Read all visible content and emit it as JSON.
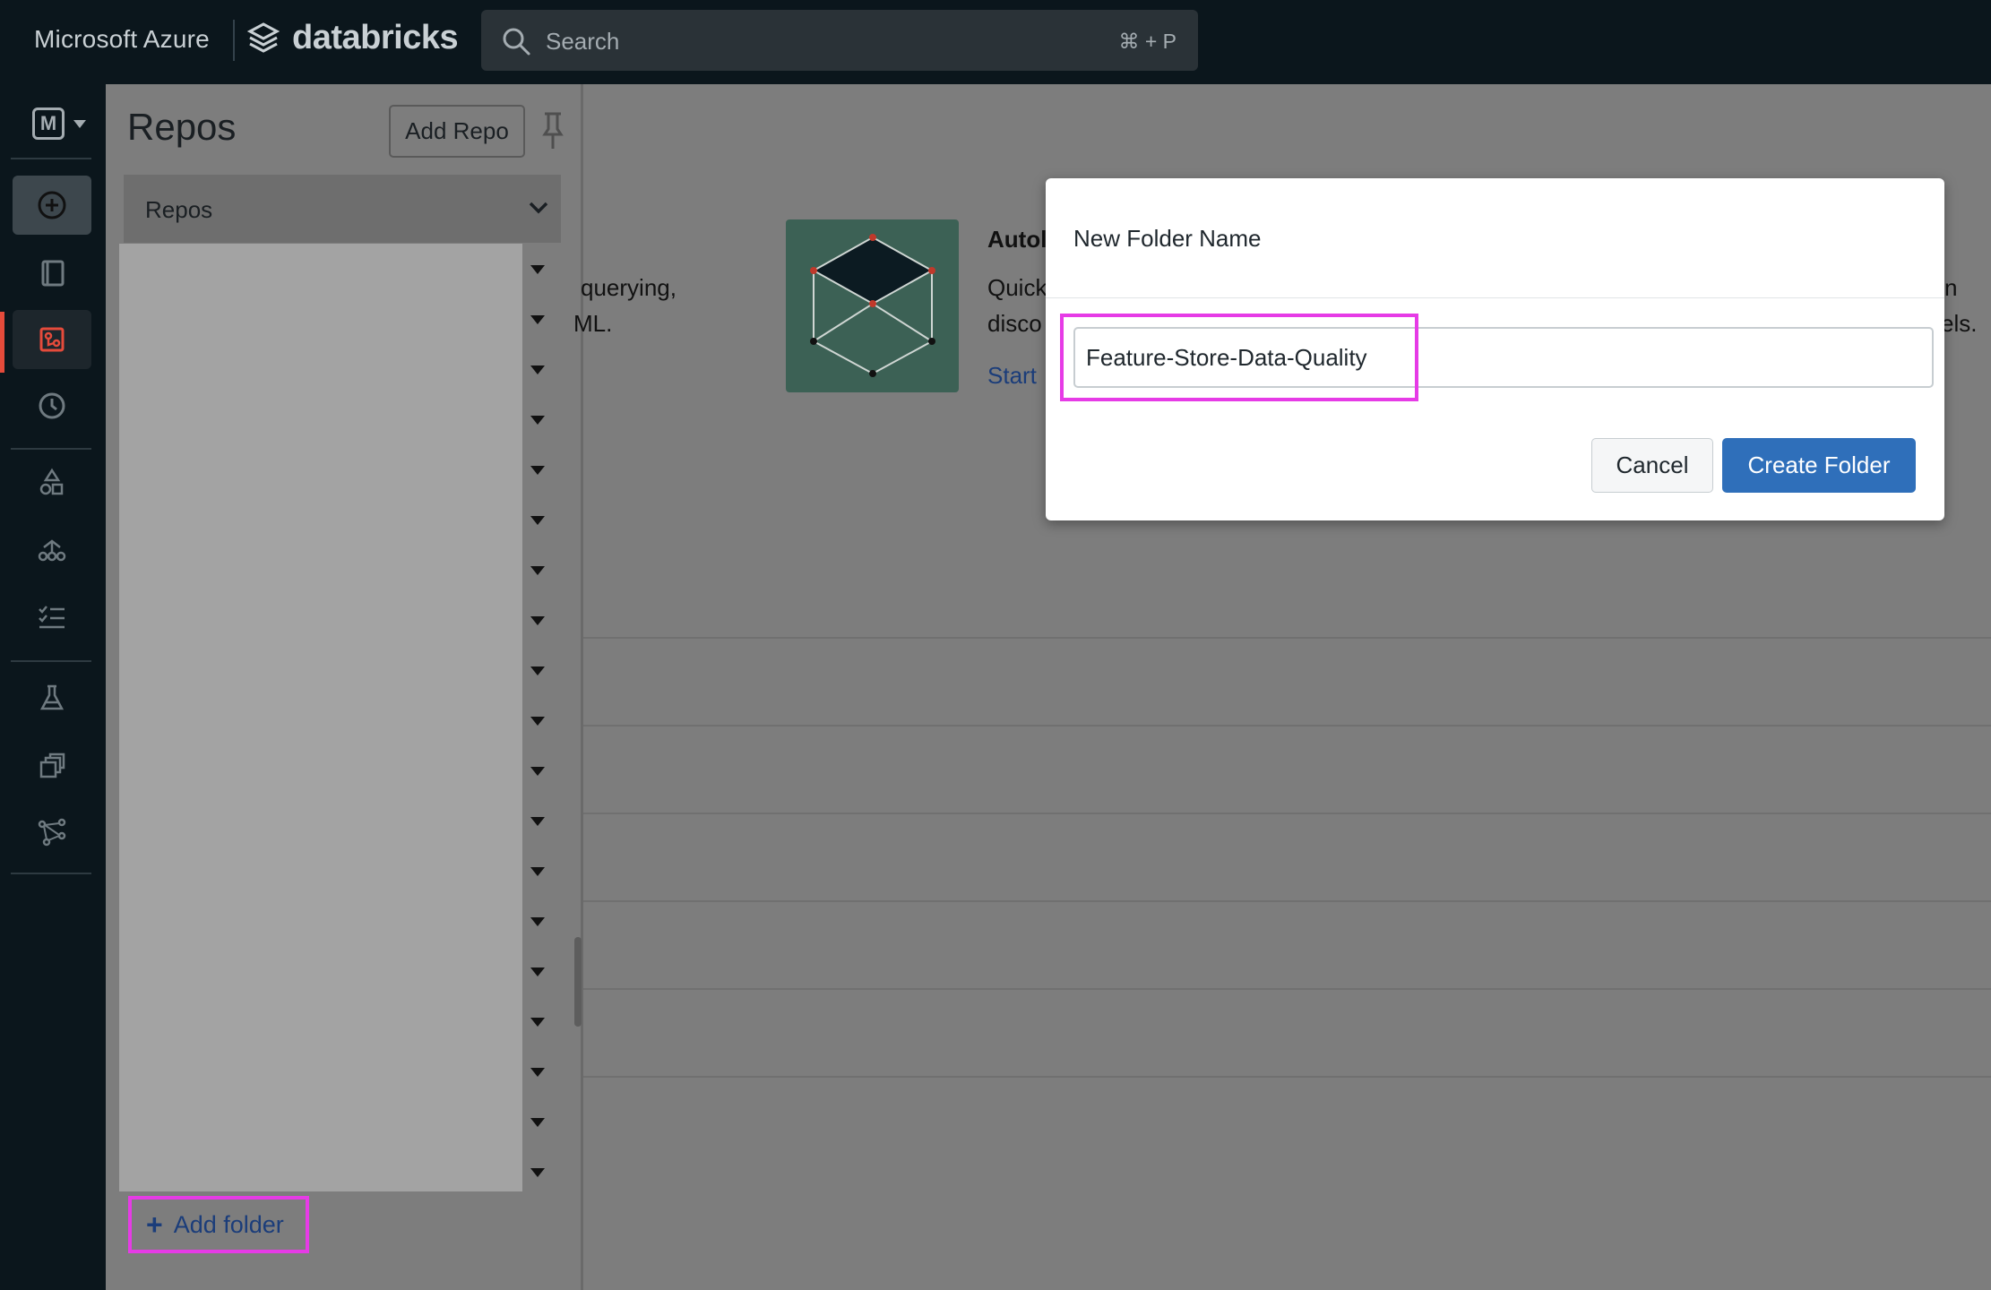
{
  "topbar": {
    "brand_azure": "Microsoft Azure",
    "brand_databricks": "databricks",
    "search_placeholder": "Search",
    "search_shortcut": "⌘ + P"
  },
  "rail": {
    "workspace_letter": "M",
    "icons": [
      "create-icon",
      "workspace-icon",
      "repos-icon",
      "recents-icon",
      "data-icon",
      "compute-icon",
      "workflows-icon",
      "experiments-icon",
      "feature-store-icon",
      "models-icon"
    ],
    "active_color": "#e54b3b"
  },
  "panel": {
    "title": "Repos",
    "add_repo_label": "Add Repo",
    "section_label": "Repos",
    "add_folder_label": "Add folder"
  },
  "background": {
    "text_querying": "querying,",
    "text_ml": "ML.",
    "text_auto": "Autol",
    "text_quick": "Quick",
    "text_disco": "disco",
    "text_start": "Start",
    "text_n": "n",
    "text_els": "els."
  },
  "modal": {
    "title": "New Folder Name",
    "input_value": "Feature-Store-Data-Quality",
    "cancel_label": "Cancel",
    "create_label": "Create Folder",
    "accent_color": "#2f6fba",
    "highlight_color": "#e63be6"
  }
}
